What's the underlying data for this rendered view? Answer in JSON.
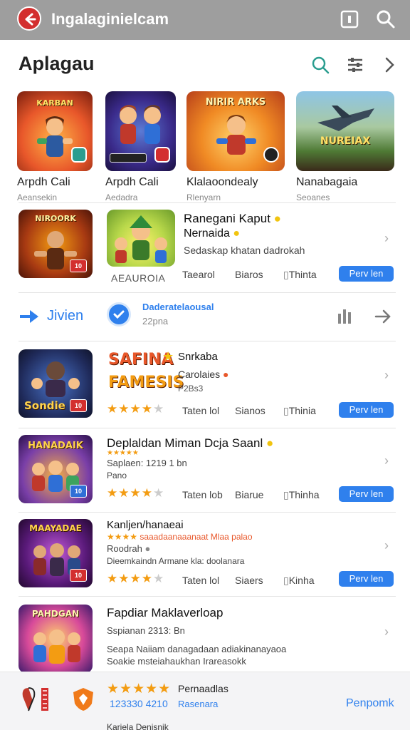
{
  "header": {
    "title": "Ingalaginielcam"
  },
  "section": {
    "title": "Aplagau"
  },
  "featured": [
    {
      "title": "Arpdh Cali",
      "subtitle": "Aeansekin",
      "art_label": "KARBAN",
      "badge_color": "#2a9d8f"
    },
    {
      "title": "Arpdh Cali",
      "subtitle": "Aedadra",
      "art_label": "",
      "badge_color": "#d32f2f"
    },
    {
      "title": "Klalaoondealy",
      "subtitle": "Rlenyarn",
      "art_label": "NIRIR ARKS",
      "badge_color": "#222222"
    },
    {
      "title": "Nanabagaia",
      "subtitle": "Seoanes",
      "art_label": "NUREIAX",
      "badge_color": ""
    }
  ],
  "row1": {
    "title": "Ranegani Kaput",
    "title2": "Nernaida",
    "subtitle": "Sedaskap khatan dadrokah",
    "art_label": "NIROORK",
    "art2_label": "AEAUROIA",
    "meta1": "Taearol",
    "meta2": "Biaros",
    "meta3": "Thinta",
    "button": "Perv len"
  },
  "arrow_row": {
    "label": "Jivien",
    "line1": "Daderatelaousal",
    "line2": "22pna"
  },
  "row2": {
    "art_label": "Sondie",
    "title1": "SAFINA",
    "title2": "FAMESIS",
    "title3": "Snrkaba",
    "subtitle": "Carolaies",
    "code": "P2Bs3",
    "rating": 4,
    "meta1": "Taten lol",
    "meta2": "Sianos",
    "meta3": "Thinia",
    "button": "Perv len"
  },
  "row3": {
    "art_label": "HANADAIK",
    "title": "Deplaldan Miman Dcja Saanl",
    "subtitle": "Saplaen: 1219 1 bn",
    "code": "Pano",
    "rating": 4,
    "meta1": "Taten lob",
    "meta2": "Biarue",
    "meta3": "Thinha",
    "button": "Perv len"
  },
  "row4": {
    "art_label": "MAAYADAE",
    "title": "Kanljen/hanaeai",
    "subtitle_orange": "saaadaanaaanaat Mlaa palao",
    "subtitle": "Roodrah",
    "description": "Dieemkaindn Armane kla: doolanara",
    "rating": 4,
    "meta1": "Taten lol",
    "meta2": "Siaers",
    "meta3": "Kinha",
    "button": "Perv len"
  },
  "row5": {
    "art_label": "PAHDGAN",
    "title": "Fapdiar Maklaverloap",
    "subtitle": "Sspianan 2313: Bn",
    "desc1": "Seapa Naiiam danagadaan adiakinanayaoa",
    "desc2": "Soakie msteiahaukhan Irareasokk"
  },
  "bottom": {
    "label": "Pernaadlas",
    "number": "123330 4210",
    "number_label": "Rasenara",
    "link": "Penpomk",
    "footer": "Kariela Denisnik",
    "rating": 5
  }
}
